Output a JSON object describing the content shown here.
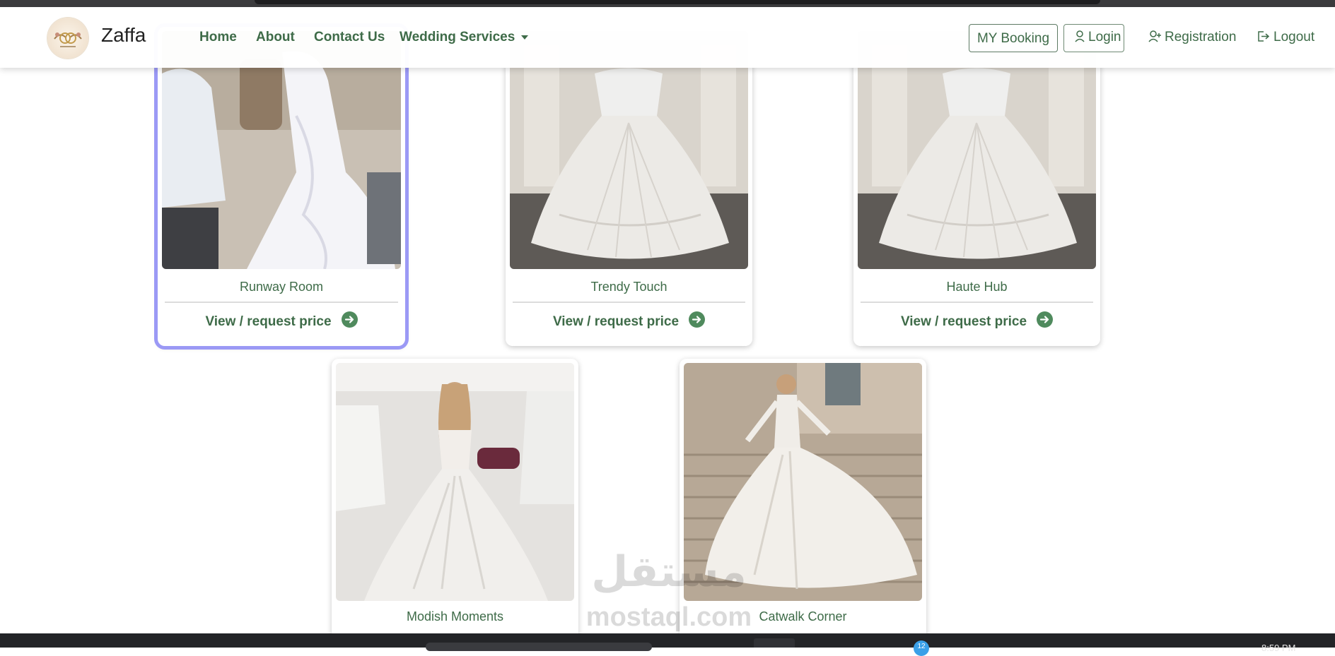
{
  "brand": {
    "name": "Zaffa",
    "logo_icon": "wedding-rings-logo"
  },
  "nav": {
    "home": "Home",
    "about": "About",
    "contact": "Contact Us",
    "wedding_services": "Wedding Services"
  },
  "auth": {
    "my_booking": "MY Booking",
    "login": "Login",
    "registration": "Registration",
    "logout": "Logout"
  },
  "cards": [
    {
      "name": "Runway Room",
      "cta": "View / request price",
      "selected": true
    },
    {
      "name": "Trendy Touch",
      "cta": "View / request price",
      "selected": false
    },
    {
      "name": "Haute Hub",
      "cta": "View / request price",
      "selected": false
    },
    {
      "name": "Modish Moments"
    },
    {
      "name": "Catwalk Corner"
    }
  ],
  "watermark": {
    "arabic": "مستقل",
    "latin": "mostaql.com"
  },
  "taskbar": {
    "badge": "12",
    "clock": "8:59 PM"
  },
  "colors": {
    "accent": "#3e6b48",
    "selected_outline": "#9b99f5",
    "arrow": "#4f8a5d"
  }
}
